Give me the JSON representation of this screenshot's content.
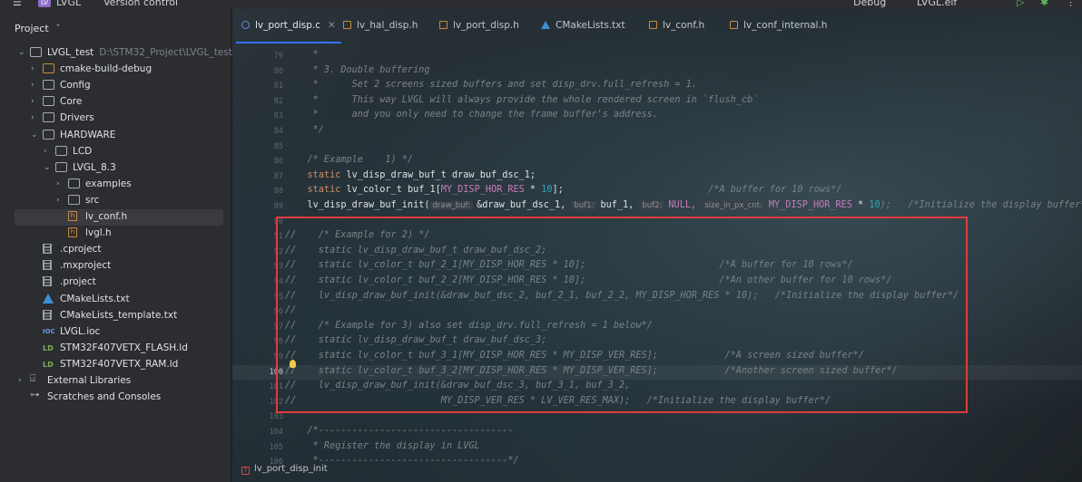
{
  "topbar": {
    "project_name": "LVGL",
    "vcs_menu": "Version control",
    "run_config": "Debug",
    "target": "LVGL.elf"
  },
  "sidebar": {
    "title": "Project",
    "items": [
      {
        "label": "LVGL_test",
        "extra": "D:\\STM32_Project\\LVGL_test",
        "kind": "folder",
        "level": 0,
        "expanded": true
      },
      {
        "label": "cmake-build-debug",
        "kind": "folder-orange",
        "level": 1,
        "expanded": false
      },
      {
        "label": "Config",
        "kind": "folder",
        "level": 1,
        "expanded": false
      },
      {
        "label": "Core",
        "kind": "folder",
        "level": 1,
        "expanded": false
      },
      {
        "label": "Drivers",
        "kind": "folder",
        "level": 1,
        "expanded": false
      },
      {
        "label": "HARDWARE",
        "kind": "folder",
        "level": 1,
        "expanded": true
      },
      {
        "label": "LCD",
        "kind": "folder",
        "level": 2,
        "expanded": false
      },
      {
        "label": "LVGL_8.3",
        "kind": "folder",
        "level": 2,
        "expanded": true
      },
      {
        "label": "examples",
        "kind": "folder",
        "level": 3,
        "expanded": false
      },
      {
        "label": "src",
        "kind": "folder",
        "level": 3,
        "expanded": false
      },
      {
        "label": "lv_conf.h",
        "kind": "h",
        "level": 3,
        "selected": true
      },
      {
        "label": "lvgl.h",
        "kind": "h",
        "level": 3
      },
      {
        "label": ".cproject",
        "kind": "doc",
        "level": 1
      },
      {
        "label": ".mxproject",
        "kind": "doc",
        "level": 1
      },
      {
        "label": ".project",
        "kind": "doc",
        "level": 1
      },
      {
        "label": "CMakeLists.txt",
        "kind": "cmake",
        "level": 1
      },
      {
        "label": "CMakeLists_template.txt",
        "kind": "doc",
        "level": 1
      },
      {
        "label": "LVGL.ioc",
        "kind": "ioc",
        "level": 1
      },
      {
        "label": "STM32F407VETX_FLASH.ld",
        "kind": "ld",
        "level": 1
      },
      {
        "label": "STM32F407VETX_RAM.ld",
        "kind": "ld",
        "level": 1
      },
      {
        "label": "External Libraries",
        "kind": "lib",
        "level": 0,
        "expanded": false
      },
      {
        "label": "Scratches and Consoles",
        "kind": "scratch",
        "level": 0
      }
    ]
  },
  "tabs": [
    {
      "label": "lv_port_disp.c",
      "icon": "c",
      "active": true
    },
    {
      "label": "lv_hal_disp.h",
      "icon": "h"
    },
    {
      "label": "lv_port_disp.h",
      "icon": "h"
    },
    {
      "label": "CMakeLists.txt",
      "icon": "cmake"
    },
    {
      "label": "lv_conf.h",
      "icon": "h"
    },
    {
      "label": "lv_conf_internal.h",
      "icon": "h"
    }
  ],
  "code": {
    "current_line": 100,
    "lines": [
      {
        "n": 79,
        "t": "     *"
      },
      {
        "n": 80,
        "t": "     * 3. Double buffering"
      },
      {
        "n": 81,
        "t": "     *      Set 2 screens sized buffers and set disp_drv.full_refresh = 1."
      },
      {
        "n": 82,
        "t": "     *      This way LVGL will always provide the whole rendered screen in `flush_cb`"
      },
      {
        "n": 83,
        "t": "     *      and you only need to change the frame buffer's address."
      },
      {
        "n": 84,
        "t": "     */"
      },
      {
        "n": 85,
        "t": ""
      },
      {
        "n": 86,
        "t": "    /* Example    1) */"
      },
      {
        "n": 87,
        "t": "    static lv_disp_draw_buf_t draw_buf_dsc_1;"
      },
      {
        "n": 88,
        "t": "    static lv_color_t buf_1[MY_DISP_HOR_RES * 10];                          /*A buffer for 10 rows*/"
      },
      {
        "n": 89,
        "t": "    lv_disp_draw_buf_init(draw_buf: &draw_buf_dsc_1, buf1: buf_1, buf2: NULL, size_in_px_cnt: MY_DISP_HOR_RES * 10);   /*Initialize the display buffer*/"
      },
      {
        "n": 90,
        "t": ""
      },
      {
        "n": 91,
        "t": "//    /* Example for 2) */"
      },
      {
        "n": 92,
        "t": "//    static lv_disp_draw_buf_t draw_buf_dsc_2;"
      },
      {
        "n": 93,
        "t": "//    static lv_color_t buf_2_1[MY_DISP_HOR_RES * 10];                        /*A buffer for 10 rows*/"
      },
      {
        "n": 94,
        "t": "//    static lv_color_t buf_2_2[MY_DISP_HOR_RES * 10];                        /*An other buffer for 10 rows*/"
      },
      {
        "n": 95,
        "t": "//    lv_disp_draw_buf_init(&draw_buf_dsc_2, buf_2_1, buf_2_2, MY_DISP_HOR_RES * 10);   /*Initialize the display buffer*/"
      },
      {
        "n": 96,
        "t": "//"
      },
      {
        "n": 97,
        "t": "//    /* Example for 3) also set disp_drv.full_refresh = 1 below*/"
      },
      {
        "n": 98,
        "t": "//    static lv_disp_draw_buf_t draw_buf_dsc_3;"
      },
      {
        "n": 99,
        "t": "//    static lv_color_t buf_3_1[MY_DISP_HOR_RES * MY_DISP_VER_RES];            /*A screen sized buffer*/"
      },
      {
        "n": 100,
        "t": "//    static lv_color_t buf_3_2[MY_DISP_HOR_RES * MY_DISP_VER_RES];            /*Another screen sized buffer*/"
      },
      {
        "n": 101,
        "t": "//    lv_disp_draw_buf_init(&draw_buf_dsc_3, buf_3_1, buf_3_2,"
      },
      {
        "n": 102,
        "t": "//                          MY_DISP_VER_RES * LV_VER_RES_MAX);   /*Initialize the display buffer*/"
      },
      {
        "n": 103,
        "t": ""
      },
      {
        "n": 104,
        "t": "    /*-----------------------------------"
      },
      {
        "n": 105,
        "t": "     * Register the display in LVGL"
      },
      {
        "n": 106,
        "t": "     *----------------------------------*/"
      }
    ]
  },
  "line89": {
    "prefix": "    lv_disp_draw_buf_init(",
    "hint1": "draw_buf:",
    "arg1": "&draw_buf_dsc_1, ",
    "hint2": "buf1:",
    "arg2": "buf_1, ",
    "hint3": "buf2:",
    "arg3": "NULL, ",
    "hint4": "size_in_px_cnt:",
    "arg4a": "MY_DISP_HOR_RES",
    "arg4b": " * ",
    "arg4c": "10",
    "suffix": ");   /*Initialize the display buffer*/"
  },
  "breadcrumb": {
    "function": "lv_port_disp_init"
  },
  "colors": {
    "highlight_box": "#e03c3c",
    "accent": "#3574f0"
  }
}
